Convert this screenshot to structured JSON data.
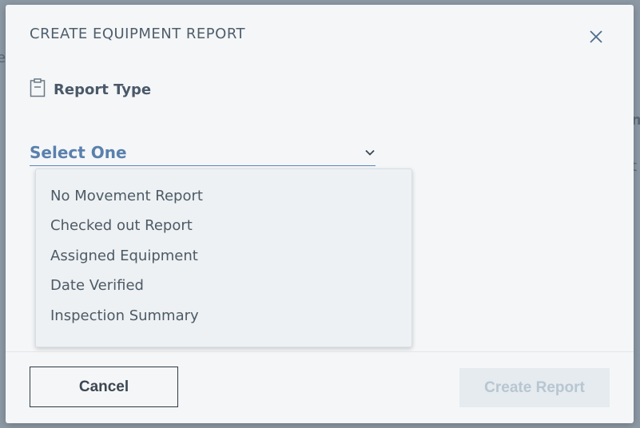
{
  "dialog": {
    "title": "CREATE EQUIPMENT REPORT",
    "report_type_label": "Report Type",
    "select": {
      "value": "Select One",
      "options": [
        "No Movement Report",
        "Checked out Report",
        "Assigned Equipment",
        "Date Verified",
        "Inspection Summary"
      ]
    },
    "footer": {
      "cancel_label": "Cancel",
      "create_label": "Create Report"
    }
  },
  "icons": {
    "close": "close-icon",
    "clipboard": "clipboard-icon",
    "chevron": "chevron-down-icon"
  },
  "colors": {
    "accent": "#5a80ad",
    "text": "#4a5968",
    "disabled_text": "#b7c6d1",
    "backdrop": "#8d9aa5"
  }
}
